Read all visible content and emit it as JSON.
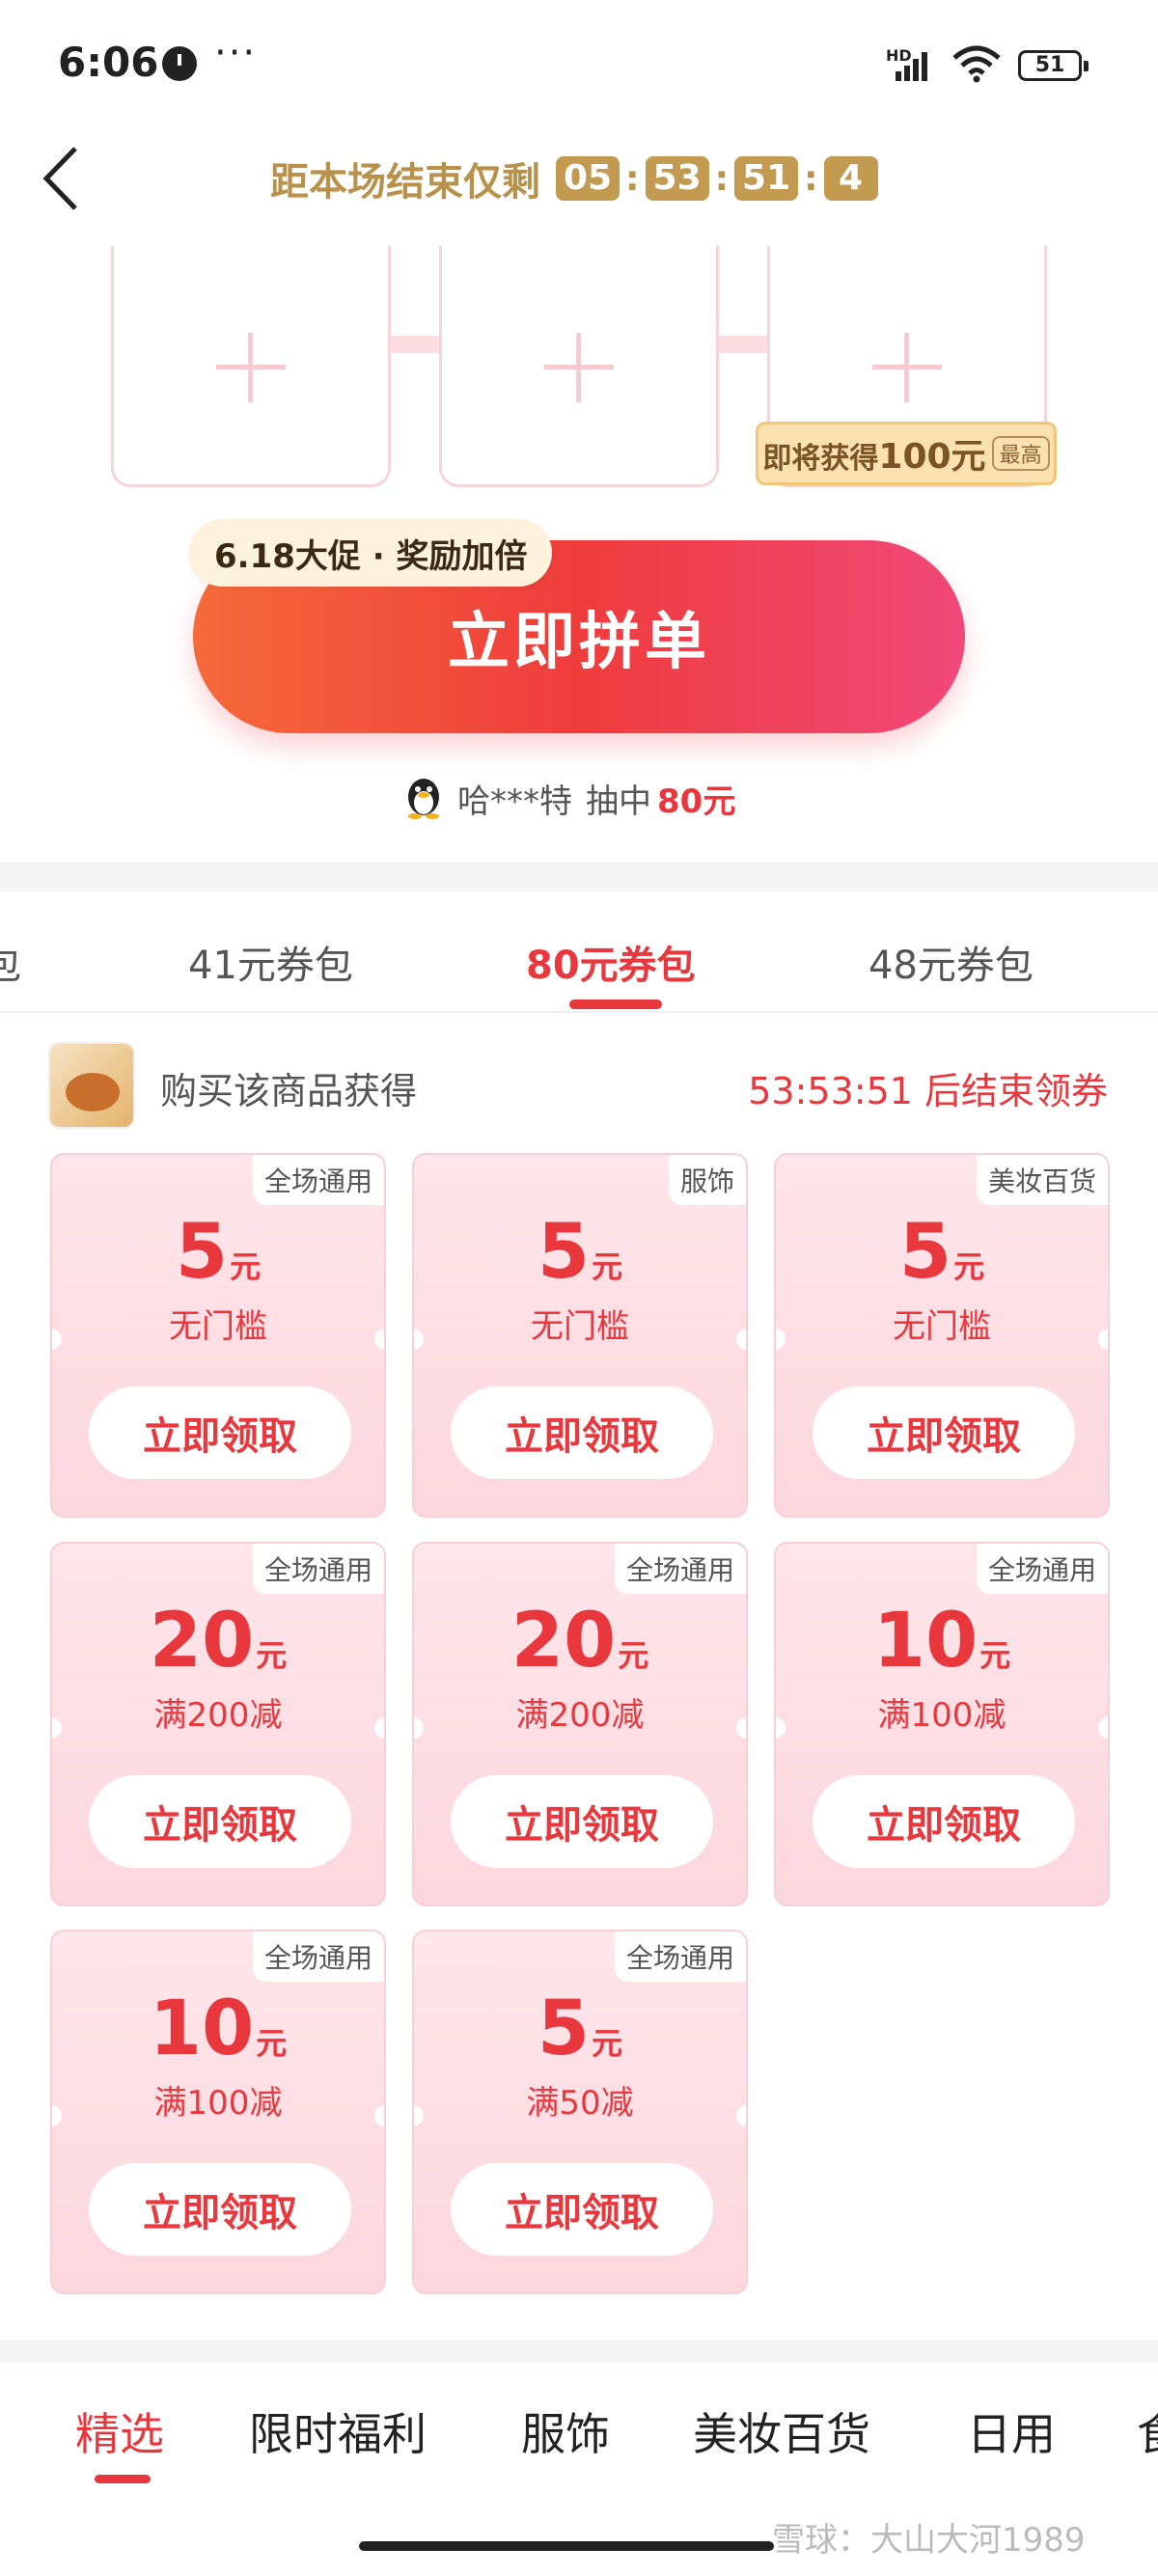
{
  "status_bar": {
    "time": "6:06",
    "dots": "···",
    "network": "HD",
    "battery": "51"
  },
  "header": {
    "back_icon": "chevron-left-icon",
    "countdown_label": "距本场结束仅剩",
    "countdown": [
      "05",
      "53",
      "51",
      "4"
    ]
  },
  "slots": {
    "reward_prefix": "即将获得",
    "reward_amount": "100元",
    "reward_badge": "最高"
  },
  "cta": {
    "promo": "6.18大促 · 奖励加倍",
    "label": "立即拼单"
  },
  "winner": {
    "name": "哈***特",
    "action": "抽中",
    "amount": "80元"
  },
  "package_tabs": [
    "包",
    "41元券包",
    "80元券包",
    "48元券包"
  ],
  "package_active": 2,
  "product": {
    "text": "购买该商品获得",
    "countdown": "53:53:51 后结束领券"
  },
  "coupons": [
    {
      "tag": "全场通用",
      "amount": "5",
      "unit": "元",
      "condition": "无门槛",
      "button": "立即领取"
    },
    {
      "tag": "服饰",
      "amount": "5",
      "unit": "元",
      "condition": "无门槛",
      "button": "立即领取"
    },
    {
      "tag": "美妆百货",
      "amount": "5",
      "unit": "元",
      "condition": "无门槛",
      "button": "立即领取"
    },
    {
      "tag": "全场通用",
      "amount": "20",
      "unit": "元",
      "condition": "满200减",
      "button": "立即领取"
    },
    {
      "tag": "全场通用",
      "amount": "20",
      "unit": "元",
      "condition": "满200减",
      "button": "立即领取"
    },
    {
      "tag": "全场通用",
      "amount": "10",
      "unit": "元",
      "condition": "满100减",
      "button": "立即领取"
    },
    {
      "tag": "全场通用",
      "amount": "10",
      "unit": "元",
      "condition": "满100减",
      "button": "立即领取"
    },
    {
      "tag": "全场通用",
      "amount": "5",
      "unit": "元",
      "condition": "满50减",
      "button": "立即领取"
    }
  ],
  "category_tabs": [
    "精选",
    "限时福利",
    "服饰",
    "美妆百货",
    "日用",
    "食"
  ],
  "category_active": 0,
  "watermark": "雪球：大山大河1989",
  "colors": {
    "accent": "#e8383e",
    "gold": "#c29a50",
    "coupon_bg": "#fde0e5"
  }
}
